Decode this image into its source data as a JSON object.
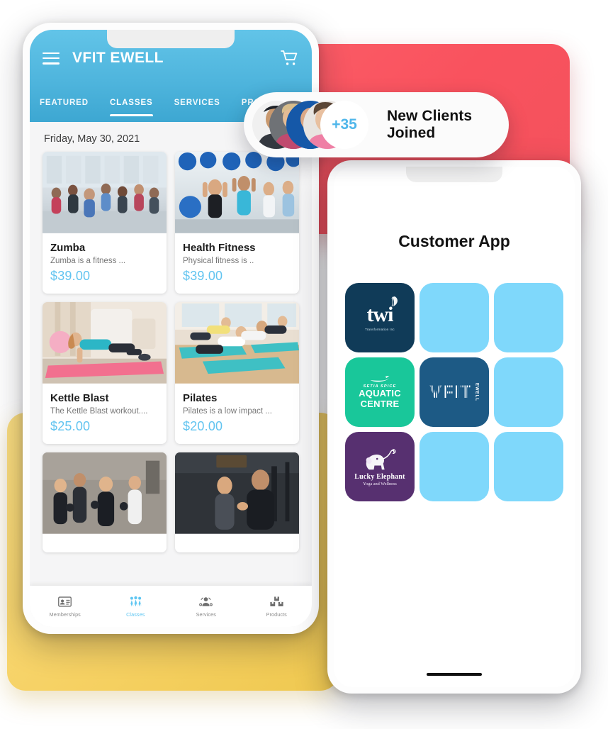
{
  "colors": {
    "red_card": "#f9525e",
    "yellow_card": "#f6d163",
    "header_blue": "#4fb5dd",
    "accent_blue": "#62c4f0",
    "placeholder_tile": "#7fd8fb"
  },
  "left_phone": {
    "app_bar": {
      "menu_icon": "hamburger-menu-icon",
      "title": "VFIT EWELL",
      "cart_icon": "shopping-cart-icon"
    },
    "tabs": [
      {
        "label": "FEATURED",
        "active": false
      },
      {
        "label": "CLASSES",
        "active": true
      },
      {
        "label": "SERVICES",
        "active": false
      },
      {
        "label": "PRODUCTS",
        "active": false
      }
    ],
    "date": "Friday, May 30, 2021",
    "classes": [
      {
        "name": "Zumba",
        "desc": "Zumba is a fitness ...",
        "price": "$39.00"
      },
      {
        "name": "Health Fitness",
        "desc": "Physical fitness is ..",
        "price": "$39.00"
      },
      {
        "name": "Kettle Blast",
        "desc": "The Kettle Blast workout....",
        "price": "$25.00"
      },
      {
        "name": "Pilates",
        "desc": "Pilates is a low impact ...",
        "price": "$20.00"
      }
    ],
    "bottom_nav": [
      {
        "label": "Memberships",
        "icon": "membership-card-icon",
        "active": false
      },
      {
        "label": "Classes",
        "icon": "group-people-icon",
        "active": true
      },
      {
        "label": "Services",
        "icon": "service-person-icon",
        "active": false
      },
      {
        "label": "Products",
        "icon": "boxes-icon",
        "active": false
      }
    ]
  },
  "notification": {
    "count": "+35",
    "text": "New Clients Joined",
    "avatar_count": 4
  },
  "right_phone": {
    "title": "Customer App",
    "tiles": [
      {
        "type": "brand",
        "id": "twi",
        "name": "twi",
        "subtitle": "Transformation Inc",
        "bg": "#103b58"
      },
      {
        "type": "placeholder",
        "id": "empty-1",
        "bg": "#7fd8fb"
      },
      {
        "type": "placeholder",
        "id": "empty-2",
        "bg": "#7fd8fb"
      },
      {
        "type": "brand",
        "id": "aquatic",
        "name": "AQUATIC CENTRE",
        "subtitle": "SETIA SPICE",
        "bg": "#19c79a"
      },
      {
        "type": "brand",
        "id": "vfit",
        "name": "VFIT",
        "subtitle": "EWELL",
        "bg": "#1d5a85"
      },
      {
        "type": "placeholder",
        "id": "empty-3",
        "bg": "#7fd8fb"
      },
      {
        "type": "brand",
        "id": "lucky-elephant",
        "name": "Lucky Elephant",
        "subtitle": "Yoga and Wellness",
        "bg": "#573070"
      },
      {
        "type": "placeholder",
        "id": "empty-4",
        "bg": "#7fd8fb"
      },
      {
        "type": "placeholder",
        "id": "empty-5",
        "bg": "#7fd8fb"
      }
    ]
  }
}
